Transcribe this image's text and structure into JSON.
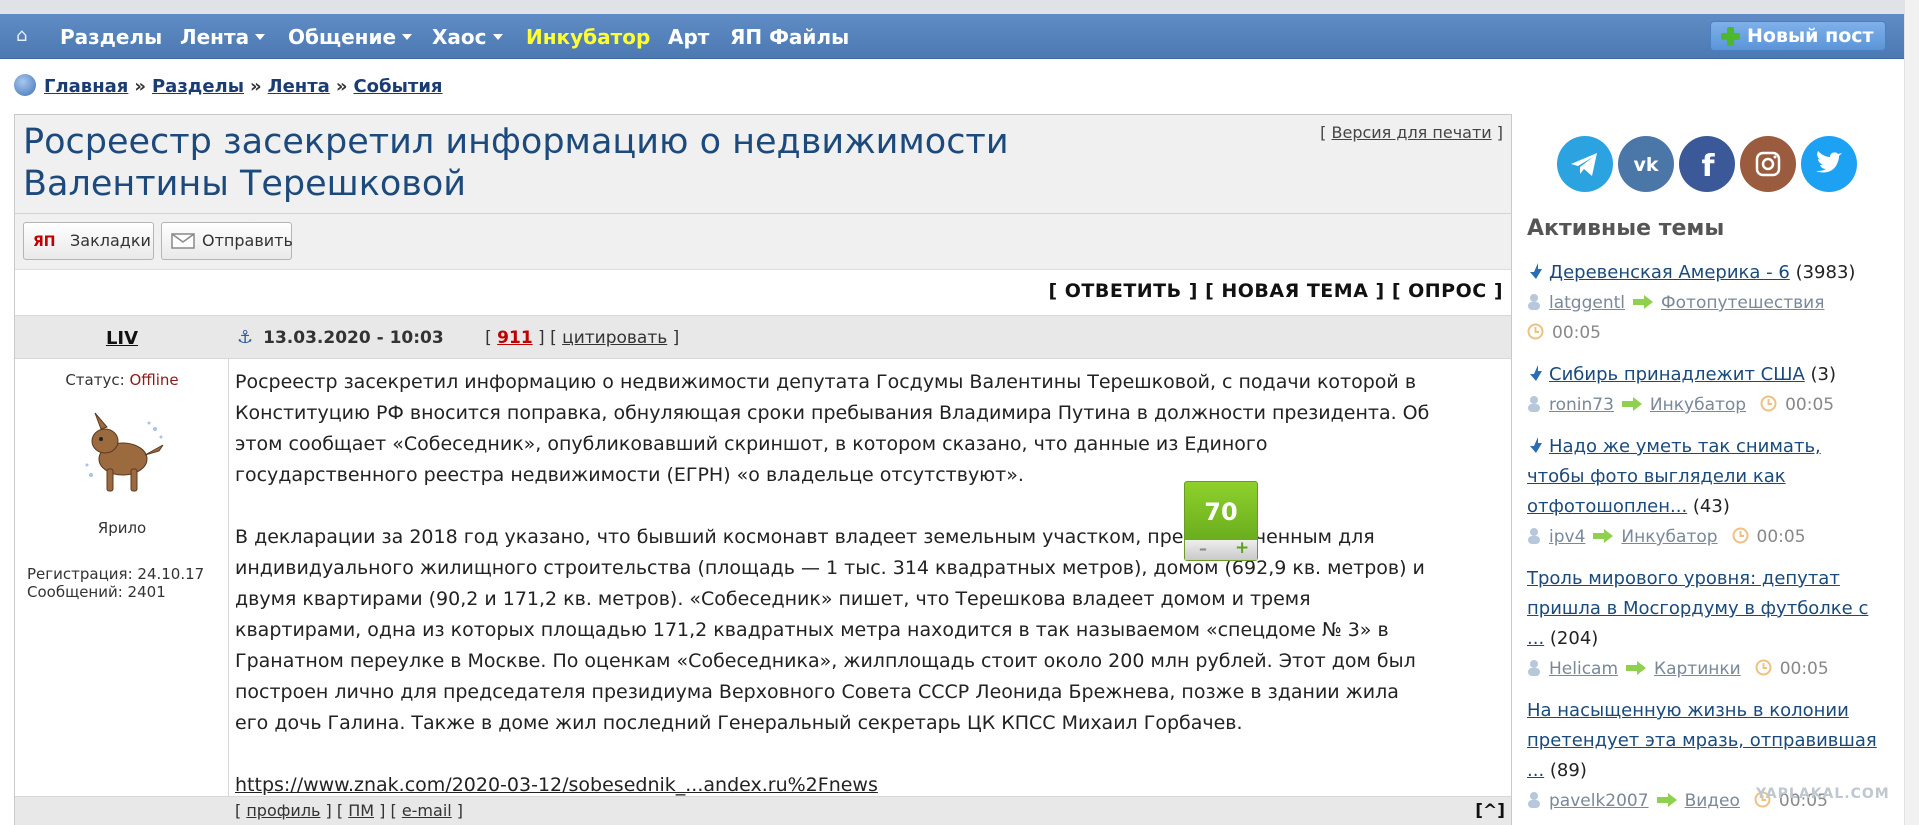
{
  "nav": {
    "items": [
      "Разделы",
      "Лента",
      "Общение",
      "Хаос",
      "Инкубатор",
      "Арт",
      "ЯП Файлы"
    ],
    "new_post": "Новый пост"
  },
  "breadcrumb": [
    "Главная",
    "Разделы",
    "Лента",
    "События"
  ],
  "breadcrumb_sep": "»",
  "topic": {
    "title": "Росреестр засекретил информацию о недвижимости Валентины Терешковой",
    "print_link": "Версия для печати",
    "share_buttons": [
      "Закладки",
      "Отправить"
    ],
    "actions": [
      "[ ОТВЕТИТЬ ]",
      "[ НОВАЯ ТЕМА ]",
      "[ ОПРОС ]"
    ]
  },
  "post": {
    "author": "LIV",
    "date": "13.03.2020 - 10:03",
    "number": "911",
    "quote": "цитировать",
    "status_label": "Статус:",
    "status_value": "Offline",
    "rank": "Ярило",
    "registration": "Регистрация: 24.10.17",
    "messages": "Сообщений: 2401",
    "rating": "70",
    "paragraphs": [
      "Росреестр засекретил информацию о недвижимости депутата Госдумы Валентины Терешковой, с подачи которой в Конституцию РФ вносится поправка, обнуляющая сроки пребывания Владимира Путина в должности президента. Об этом сообщает «Собеседник», опубликовавший скриншот, в котором сказано, что данные из Единого государственного реестра недвижимости (ЕГРН) «о владельце отсутствуют».",
      "В декларации за 2018 год указано, что бывший космонавт владеет земельным участком, предназначенным для индивидуального жилищного строительства (площадь — 1 тыс. 314 квадратных метров), домом (692,9 кв. метров) и двумя квартирами (90,2 и 171,2 кв. метров). «Собеседник» пишет, что Терешкова владеет домом и тремя квартирами, одна из которых площадью 171,2 квадратных метра находится в так называемом «спецдоме № 3» в Гранатном переулке в Москве. По оценкам «Собеседника», жилплощадь стоит около 200 млн рублей. Этот дом был построен лично для председателя президиума Верховного Совета СССР Леонида Брежнева, позже в здании жила его дочь Галина. Также в доме жил последний Генеральный секретарь ЦК КПСС Михаил Горбачев."
    ],
    "link": "https://www.znak.com/2020-03-12/sobesednik_...andex.ru%2Fnews",
    "footer_links": [
      "профиль",
      "ПМ",
      "e-mail"
    ],
    "to_top": "[^]"
  },
  "sidebar": {
    "heading": "Активные темы",
    "topics": [
      {
        "title": "Деревенская Америка - 6",
        "count": "(3983)",
        "user": "latggentl",
        "section": "Фотопутешествия",
        "time": "00:05",
        "hot": true
      },
      {
        "title": "Сибирь принадлежит США",
        "count": "(3)",
        "user": "ronin73",
        "section": "Инкубатор",
        "time": "00:05",
        "hot": true
      },
      {
        "title": "Надо же уметь так снимать, чтобы фото выглядели как отфотошоплен...",
        "count": "(43)",
        "user": "ipv4",
        "section": "Инкубатор",
        "time": "00:05",
        "hot": true
      },
      {
        "title": "Троль мирового уровня: депутат пришла в Мосгордуму в футболке с ...",
        "count": "(204)",
        "user": "Helicam",
        "section": "Картинки",
        "time": "00:05",
        "hot": false
      },
      {
        "title": "На насыщенную жизнь в колонии претендует эта мразь, отправившая ...",
        "count": "(89)",
        "user": "pavelk2007",
        "section": "Видео",
        "time": "00:05",
        "hot": false
      }
    ],
    "social": [
      "telegram-icon",
      "vk-icon",
      "facebook-icon",
      "instagram-icon",
      "twitter-icon"
    ]
  },
  "watermark": "YAPLAKAL.COM",
  "colors": {
    "nav_bg": "#5580bb",
    "title": "#1c4a7c",
    "link": "#1a4a7c",
    "rating": "#7bc025",
    "offline": "#8b1a1a"
  }
}
